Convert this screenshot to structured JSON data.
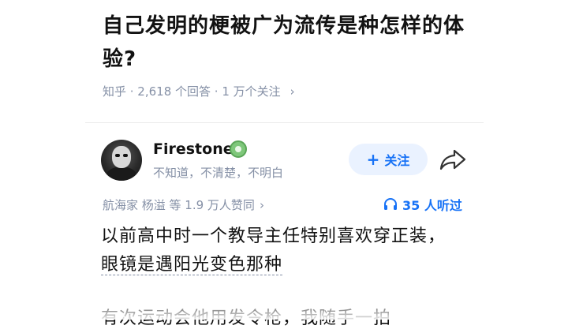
{
  "question": {
    "title": "自己发明的梗被广为流传是种怎样的体验?",
    "meta": "知乎 · 2,618 个回答 · 1 万个关注",
    "meta_chevron": "›"
  },
  "author": {
    "name": "Firestone",
    "bio": "不知道，不清楚，不明白",
    "badge_icon": "verified-badge-icon",
    "avatar_icon": "user-avatar"
  },
  "actions": {
    "follow_plus": "+",
    "follow_label": "关注",
    "share_icon": "share-arrow-icon"
  },
  "engagement": {
    "voters": "航海家 杨溢 等 1.9 万人赞同",
    "voters_chevron": "›",
    "listen_count": "35 人听过",
    "listen_icon": "headphones-icon"
  },
  "answer": {
    "line1": "以前高中时一个教导主任特别喜欢穿正装，",
    "line2": "眼镜是遇阳光变色那种",
    "line3": "有次运动会他用发令枪，我随手一拍"
  },
  "colors": {
    "accent": "#1772f6",
    "meta": "#8590a6",
    "text": "#121212",
    "badge": "#7ec77a"
  }
}
